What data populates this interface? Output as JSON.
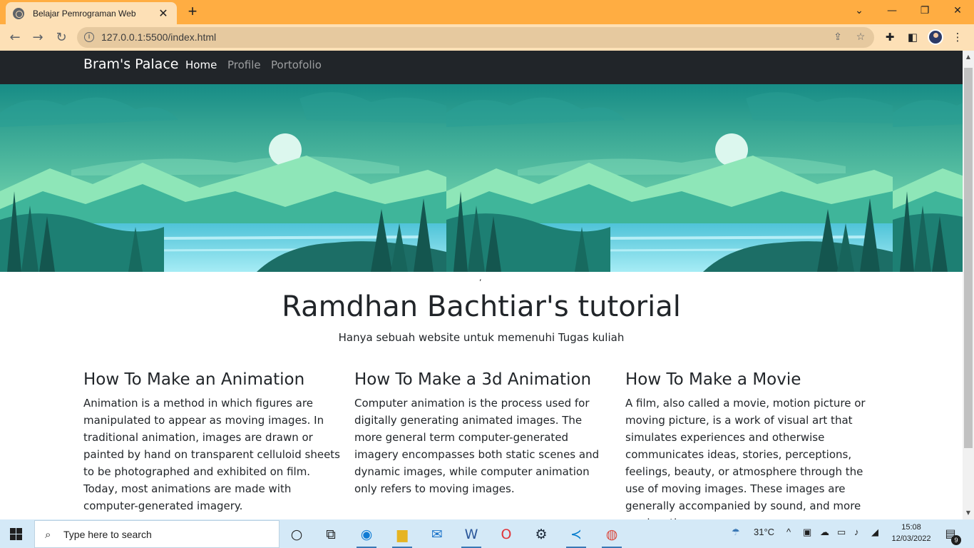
{
  "browser": {
    "tab_title": "Belajar Pemrograman Web",
    "tab_close": "✕",
    "new_tab": "+",
    "url": "127.0.0.1:5500/index.html",
    "window_controls": {
      "minimize": "—",
      "restore": "❐",
      "close": "✕",
      "tab_search": "⌄"
    }
  },
  "site": {
    "brand": "Bram's Palace",
    "nav": [
      {
        "label": "Home",
        "active": true
      },
      {
        "label": "Profile",
        "active": false
      },
      {
        "label": "Portofolio",
        "active": false
      }
    ],
    "stray_comma": ",",
    "title": "Ramdhan Bachtiar's tutorial",
    "subtitle": "Hanya sebuah website untuk memenuhi Tugas kuliah",
    "columns": [
      {
        "heading": "How To Make an Animation",
        "body": "Animation is a method in which figures are manipulated to appear as moving images. In traditional animation, images are drawn or painted by hand on transparent celluloid sheets to be photographed and exhibited on film. Today, most animations are made with computer-generated imagery."
      },
      {
        "heading": "How To Make a 3d Animation",
        "body": "Computer animation is the process used for digitally generating animated images. The more general term computer-generated imagery encompasses both static scenes and dynamic images, while computer animation only refers to moving images."
      },
      {
        "heading": "How To Make a Movie",
        "body": "A film, also called a movie, motion picture or moving picture, is a work of visual art that simulates experiences and otherwise communicates ideas, stories, perceptions, feelings, beauty, or atmosphere through the use of moving images. These images are generally accompanied by sound, and more rarely, other sensory"
      }
    ]
  },
  "taskbar": {
    "search_placeholder": "Type here to search",
    "temperature": "31°C",
    "time": "15:08",
    "date": "12/03/2022",
    "notification_count": "9"
  },
  "colors": {
    "tab_strip": "#ffad42",
    "toolbar": "#fde0b6",
    "site_nav": "#212529",
    "taskbar": "#d4e9f7"
  }
}
